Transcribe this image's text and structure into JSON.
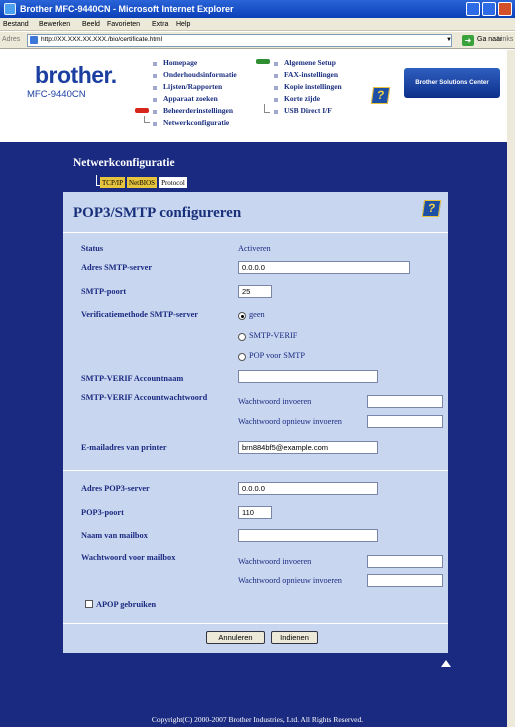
{
  "window": {
    "title": "Brother MFC-9440CN - Microsoft Internet Explorer"
  },
  "menu": [
    "Bestand",
    "Bewerken",
    "Beeld",
    "Favorieten",
    "Extra",
    "Help"
  ],
  "address": {
    "label": "Adres",
    "url": "http://XX.XXX.XX.XXX./bio/certificate.html",
    "go_label": "Ga naar",
    "links_label": "Links"
  },
  "header": {
    "logo": "brother.",
    "model": "MFC-9440CN",
    "nav_left": [
      "Homepage",
      "Onderhoudsinformatie",
      "Lijsten/Rapporten",
      "Apparaat zoeken",
      "Beheerderinstellingen",
      "Netwerkconfiguratie"
    ],
    "nav_right": [
      "Algemene Setup",
      "FAX-instellingen",
      "Kopie instellingen",
      "Korte zijde",
      "USB Direct I/F"
    ],
    "solutions_center": "Brother Solutions Center",
    "help_glyph": "?"
  },
  "section": {
    "title": "Netwerkconfiguratie",
    "tabs": [
      "TCP/IP",
      "NetBIOS",
      "Protocol"
    ]
  },
  "form": {
    "title": "POP3/SMTP configureren",
    "status_label": "Status",
    "status_value": "Activeren",
    "smtp_server_label": "Adres SMTP-server",
    "smtp_server_value": "0.0.0.0",
    "smtp_port_label": "SMTP-poort",
    "smtp_port_value": "25",
    "auth_method_label": "Verificatiemethode SMTP-server",
    "auth_options": [
      "geen",
      "SMTP-VERIF",
      "POP voor SMTP"
    ],
    "auth_selected": "geen",
    "smtp_account_name_label": "SMTP-VERIF Accountnaam",
    "smtp_account_pw_label": "SMTP-VERIF Accountwachtwoord",
    "pw_enter_label": "Wachtwoord invoeren",
    "pw_reenter_label": "Wachtwoord opnieuw invoeren",
    "printer_email_label": "E-mailadres van printer",
    "printer_email_value": "brn884bf5@example.com",
    "pop3_server_label": "Adres POP3-server",
    "pop3_server_value": "0.0.0.0",
    "pop3_port_label": "POP3-poort",
    "pop3_port_value": "110",
    "mailbox_name_label": "Naam van mailbox",
    "mailbox_pw_label": "Wachtwoord voor mailbox",
    "apop_label": "APOP gebruiken",
    "cancel_label": "Annuleren",
    "submit_label": "Indienen"
  },
  "footer": {
    "copyright": "Copyright(C) 2000-2007 Brother Industries, Ltd. All Rights Reserved."
  },
  "colors": {
    "page_bg": "#1a2a80",
    "panel_bg": "#c9d6f0",
    "tab_active": "#e7c43e"
  }
}
